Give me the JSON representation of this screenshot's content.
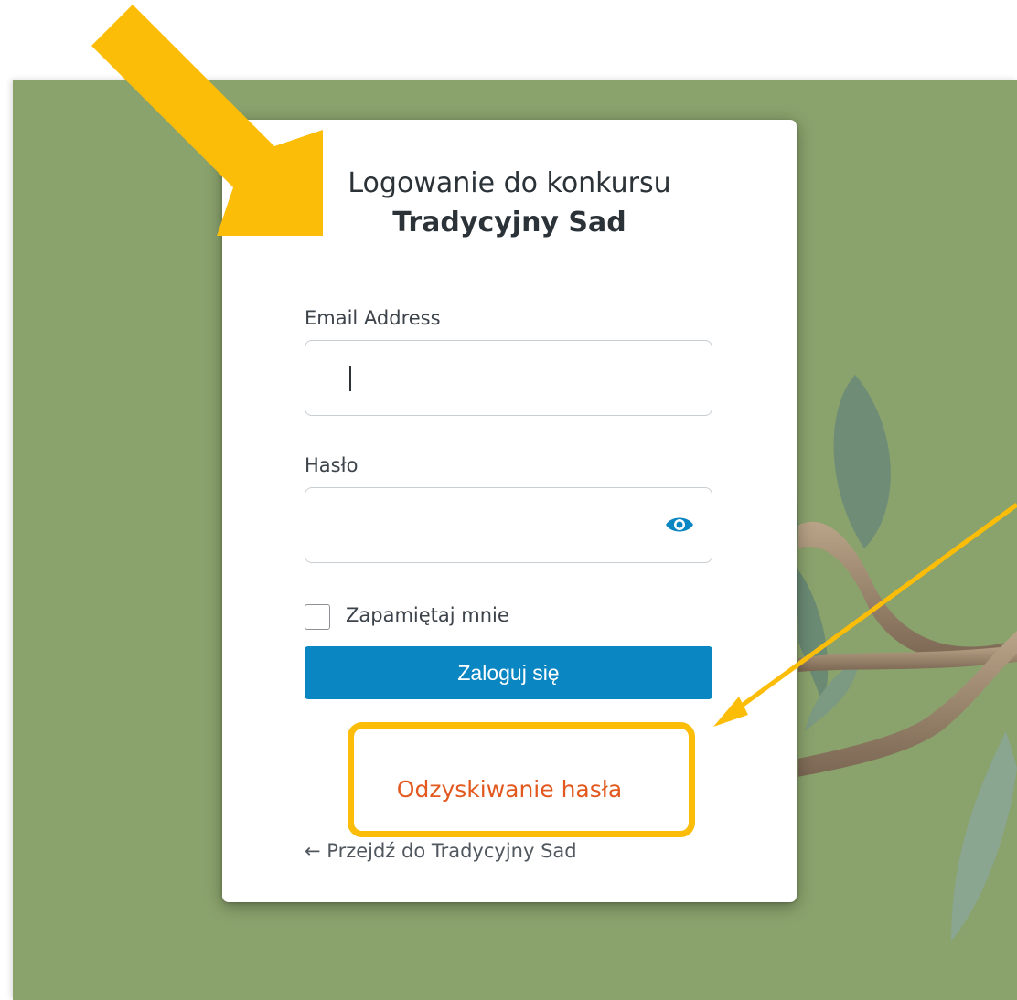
{
  "login": {
    "title_line1": "Logowanie do konkursu",
    "title_line2": "Tradycyjny Sad",
    "email_label": "Email Address",
    "email_value": "",
    "password_label": "Hasło",
    "password_value": "",
    "remember_label": "Zapamiętaj mnie",
    "remember_checked": false,
    "submit_label": "Zaloguj się",
    "recover_link": "Odzyskiwanie hasła",
    "back_link": "← Przejdź do Tradycyjny Sad"
  },
  "icons": {
    "password_toggle": "eye-icon"
  },
  "colors": {
    "background": "#8aa26c",
    "button": "#0a86c2",
    "link_accent": "#e2581e",
    "highlight": "#fbbd08"
  }
}
